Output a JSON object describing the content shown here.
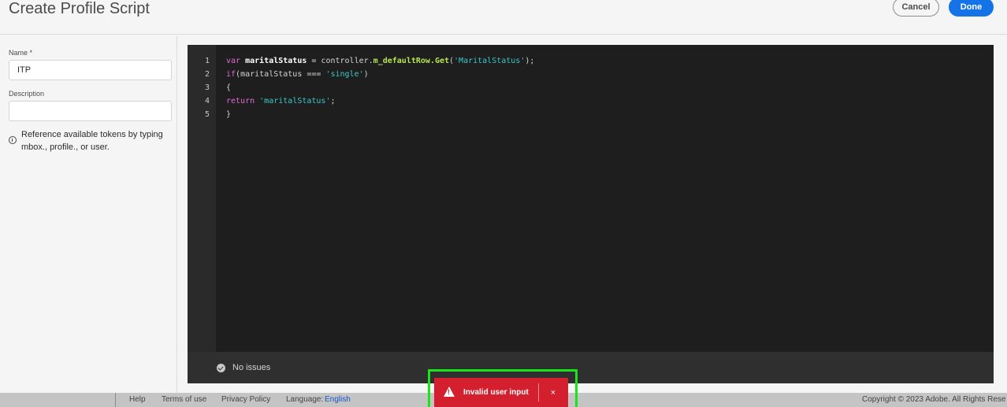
{
  "header": {
    "title": "Create Profile Script",
    "cancel_label": "Cancel",
    "done_label": "Done"
  },
  "sidebar": {
    "name_label": "Name *",
    "name_value": "ITP",
    "description_label": "Description",
    "description_value": "",
    "info_text": "Reference available tokens by typing mbox., profile., or user."
  },
  "editor": {
    "line_numbers": [
      "1",
      "2",
      "3",
      "4",
      "5"
    ],
    "lines": [
      [
        [
          "kw",
          "var "
        ],
        [
          "id-bold",
          "maritalStatus"
        ],
        [
          "plain",
          " = controller."
        ],
        [
          "fn",
          "m_defaultRow.Get"
        ],
        [
          "plain",
          "("
        ],
        [
          "str",
          "'MaritalStatus'"
        ],
        [
          "plain",
          ");"
        ]
      ],
      [
        [
          "kw",
          "if"
        ],
        [
          "plain",
          "(maritalStatus === "
        ],
        [
          "str",
          "'single'"
        ],
        [
          "plain",
          ")"
        ]
      ],
      [
        [
          "plain",
          "{"
        ]
      ],
      [
        [
          "kw",
          "return "
        ],
        [
          "str",
          "'maritalStatus'"
        ],
        [
          "plain",
          ";"
        ]
      ],
      [
        [
          "plain",
          "}"
        ]
      ]
    ],
    "status": "No issues"
  },
  "footer": {
    "help": "Help",
    "terms": "Terms of use",
    "privacy": "Privacy Policy",
    "language_label": "Language:",
    "language_value": "English",
    "copyright": "Copyright © 2023 Adobe. All Rights Rese"
  },
  "toast": {
    "message": "Invalid user input",
    "close_glyph": "×",
    "icon": "alert-triangle-icon",
    "color": "#d31f2e"
  },
  "colors": {
    "accent": "#1473e6",
    "highlight": "#19e619"
  }
}
